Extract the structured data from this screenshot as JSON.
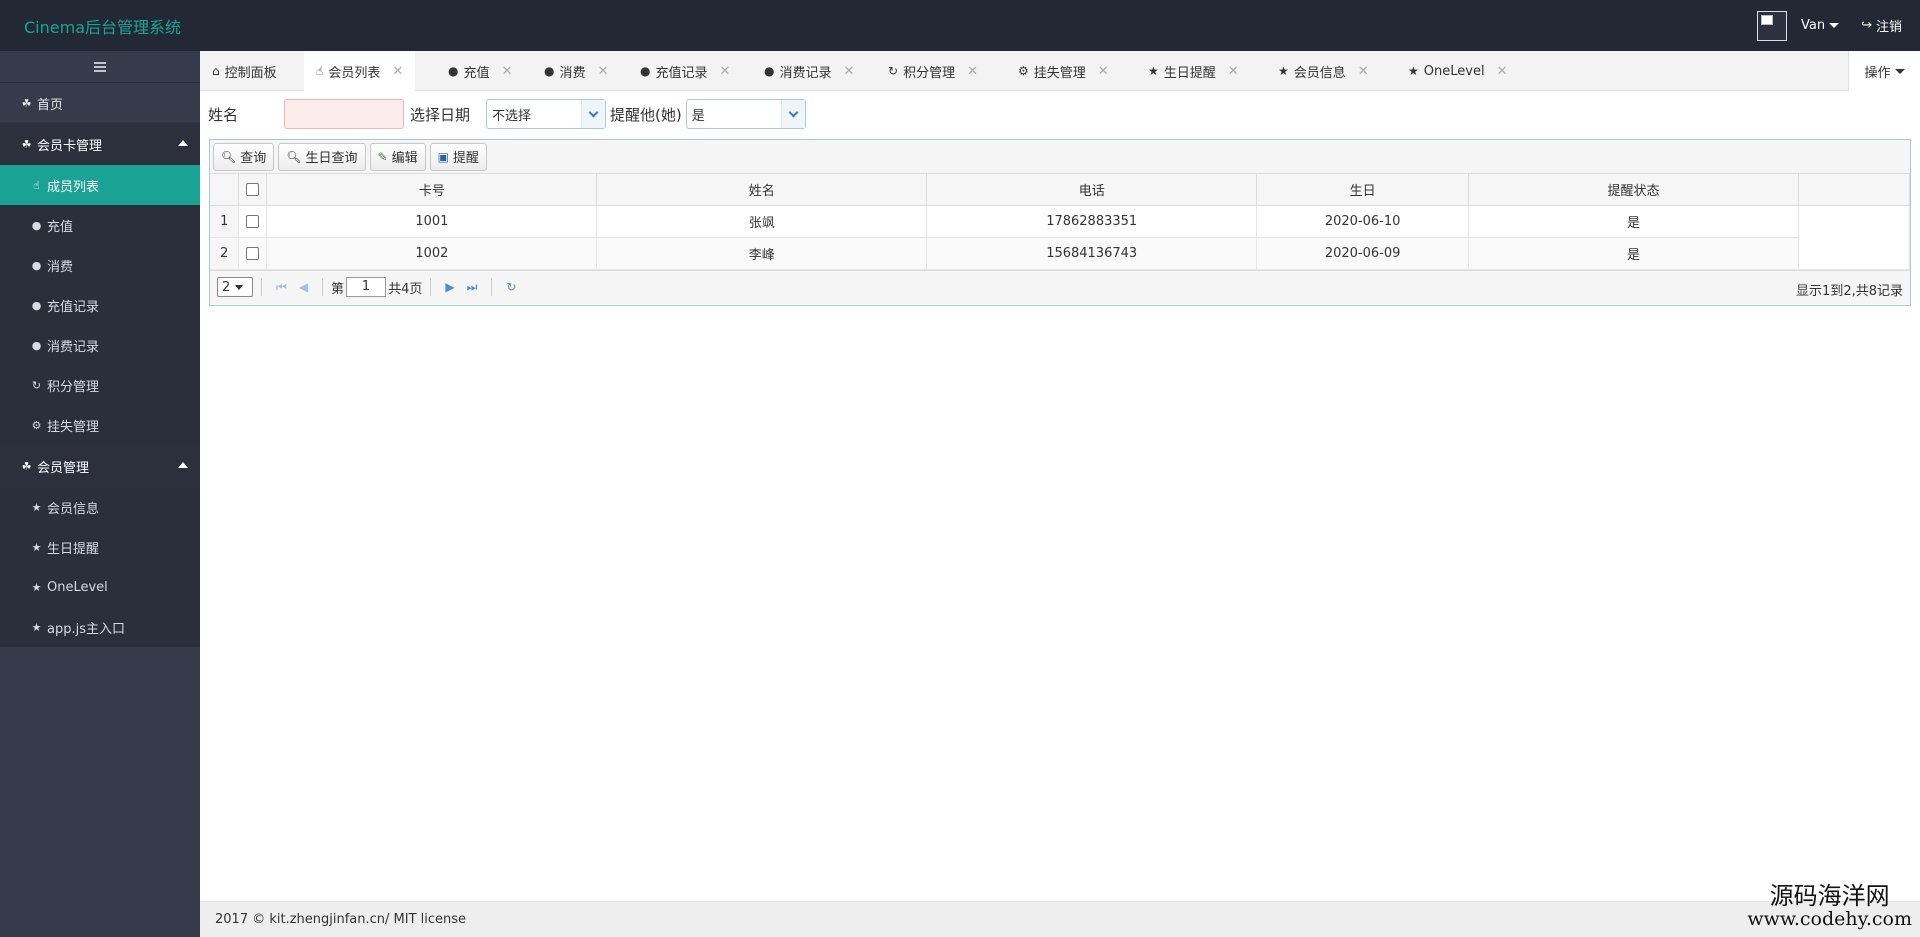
{
  "app": {
    "title": "Cinema后台管理系统"
  },
  "header": {
    "user": "Van",
    "logout": "注销"
  },
  "sidebar": {
    "home": "首页",
    "groups": [
      {
        "label": "会员卡管理",
        "items": [
          "成员列表",
          "充值",
          "消费",
          "充值记录",
          "消费记录",
          "积分管理",
          "挂失管理"
        ],
        "active": "成员列表"
      },
      {
        "label": "会员管理",
        "items": [
          "会员信息",
          "生日提醒",
          "OneLevel",
          "app.js主入口"
        ]
      }
    ]
  },
  "tabs": [
    "控制面板",
    "会员列表",
    "充值",
    "消费",
    "充值记录",
    "消费记录",
    "积分管理",
    "挂失管理",
    "生日提醒",
    "会员信息",
    "OneLevel"
  ],
  "tabs_active": "会员列表",
  "ops_label": "操作",
  "filters": {
    "name_label": "姓名",
    "name_value": "",
    "date_label": "选择日期",
    "date_value": "不选择",
    "remind_label": "提醒他(她)",
    "remind_value": "是"
  },
  "toolbar": {
    "query": "查询",
    "birthday_query": "生日查询",
    "edit": "编辑",
    "remind": "提醒"
  },
  "table": {
    "columns": [
      "卡号",
      "姓名",
      "电话",
      "生日",
      "提醒状态"
    ],
    "rows": [
      {
        "no": "1",
        "card": "1001",
        "name": "张飒",
        "phone": "17862883351",
        "birthday": "2020-06-10",
        "status": "是"
      },
      {
        "no": "2",
        "card": "1002",
        "name": "李峰",
        "phone": "15684136743",
        "birthday": "2020-06-09",
        "status": "是"
      }
    ]
  },
  "pager": {
    "page_size": "2",
    "page_prefix": "第",
    "page": "1",
    "page_suffix": "共4页",
    "info": "显示1到2,共8记录"
  },
  "footer": {
    "text": "2017 © kit.zhengjinfan.cn/ MIT license"
  },
  "watermark": {
    "line1": "源码海洋网",
    "line2": "www.codehy.com"
  },
  "colors": {
    "accent": "#1aa394",
    "topbar": "#232835",
    "sidebar": "#353b4a"
  }
}
